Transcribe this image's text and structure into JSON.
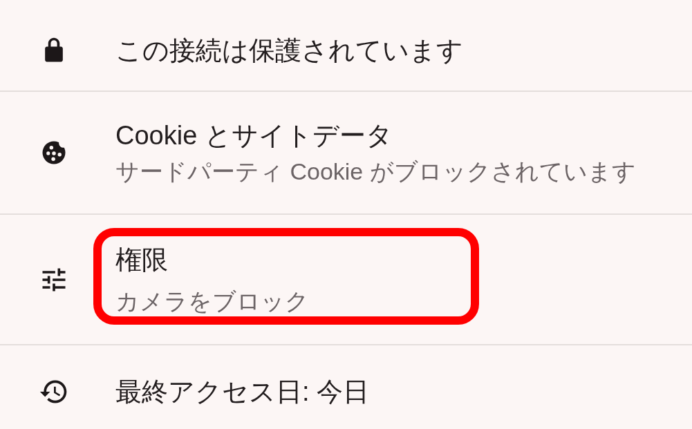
{
  "site_info": {
    "items": [
      {
        "title": "この接続は保護されています",
        "highlighted": false
      },
      {
        "title": "Cookie とサイトデータ",
        "subtitle": "サードパーティ Cookie がブロックされています",
        "highlighted": false
      },
      {
        "title": "権限",
        "subtitle": "カメラをブロック",
        "highlighted": true
      },
      {
        "title": "最終アクセス日: 今日",
        "highlighted": false
      }
    ]
  }
}
